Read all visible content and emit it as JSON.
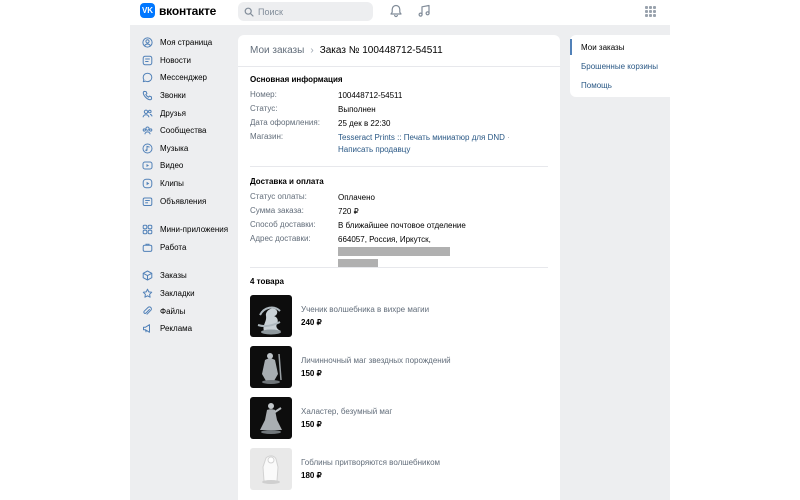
{
  "header": {
    "logo_text": "вконтакте",
    "logo_mark": "VK",
    "search_placeholder": "Поиск",
    "icons": [
      "search-icon",
      "bell-icon",
      "music-icon",
      "apps-icon"
    ]
  },
  "sidebar": {
    "items": [
      {
        "label": "Моя страница",
        "icon": "user-icon"
      },
      {
        "label": "Новости",
        "icon": "news-icon"
      },
      {
        "label": "Мессенджер",
        "icon": "chat-icon"
      },
      {
        "label": "Звонки",
        "icon": "phone-icon"
      },
      {
        "label": "Друзья",
        "icon": "friends-icon"
      },
      {
        "label": "Сообщества",
        "icon": "groups-icon"
      },
      {
        "label": "Музыка",
        "icon": "music-icon"
      },
      {
        "label": "Видео",
        "icon": "video-icon"
      },
      {
        "label": "Клипы",
        "icon": "clips-icon"
      },
      {
        "label": "Объявления",
        "icon": "ads-icon"
      },
      {
        "label": "Мини-приложения",
        "icon": "mini-apps-icon"
      },
      {
        "label": "Работа",
        "icon": "work-icon"
      },
      {
        "label": "Заказы",
        "icon": "orders-icon"
      },
      {
        "label": "Закладки",
        "icon": "bookmarks-icon"
      },
      {
        "label": "Файлы",
        "icon": "files-icon"
      },
      {
        "label": "Реклама",
        "icon": "advertising-icon"
      }
    ]
  },
  "breadcrumb": {
    "parent": "Мои заказы",
    "current": "Заказ № 100448712-54511"
  },
  "basic": {
    "title": "Основная информация",
    "number_label": "Номер:",
    "number_value": "100448712-54511",
    "status_label": "Статус:",
    "status_value": "Выполнен",
    "date_label": "Дата оформления:",
    "date_value": "25 дек в 22:30",
    "shop_label": "Магазин:",
    "shop_value": "Tesseract Prints :: Печать миниатюр для DND",
    "shop_sep": "·",
    "contact_link": "Написать продавцу"
  },
  "delivery": {
    "title": "Доставка и оплата",
    "pay_status_label": "Статус оплаты:",
    "pay_status_value": "Оплачено",
    "sum_label": "Сумма заказа:",
    "sum_value": "720 ₽",
    "method_label": "Способ доставки:",
    "method_value": "В ближайшее почтовое отделение",
    "address_label": "Адрес доставки:",
    "address_value": "664057, Россия, Иркутск,"
  },
  "products": {
    "title": "4 товара",
    "items": [
      {
        "name": "Ученик волшебника в вихре магии",
        "price": "240 ₽"
      },
      {
        "name": "Личинночный маг звездных порождений",
        "price": "150 ₽"
      },
      {
        "name": "Халастер, безумный маг",
        "price": "150 ₽"
      },
      {
        "name": "Гоблины притворяются волшебником",
        "price": "180 ₽"
      }
    ]
  },
  "right_menu": {
    "items": [
      "Мои заказы",
      "Брошенные корзины",
      "Помощь"
    ]
  },
  "colors": {
    "brand": "#0077ff",
    "link": "#2a5885",
    "muted": "#626d7a",
    "background": "#edeef0"
  }
}
